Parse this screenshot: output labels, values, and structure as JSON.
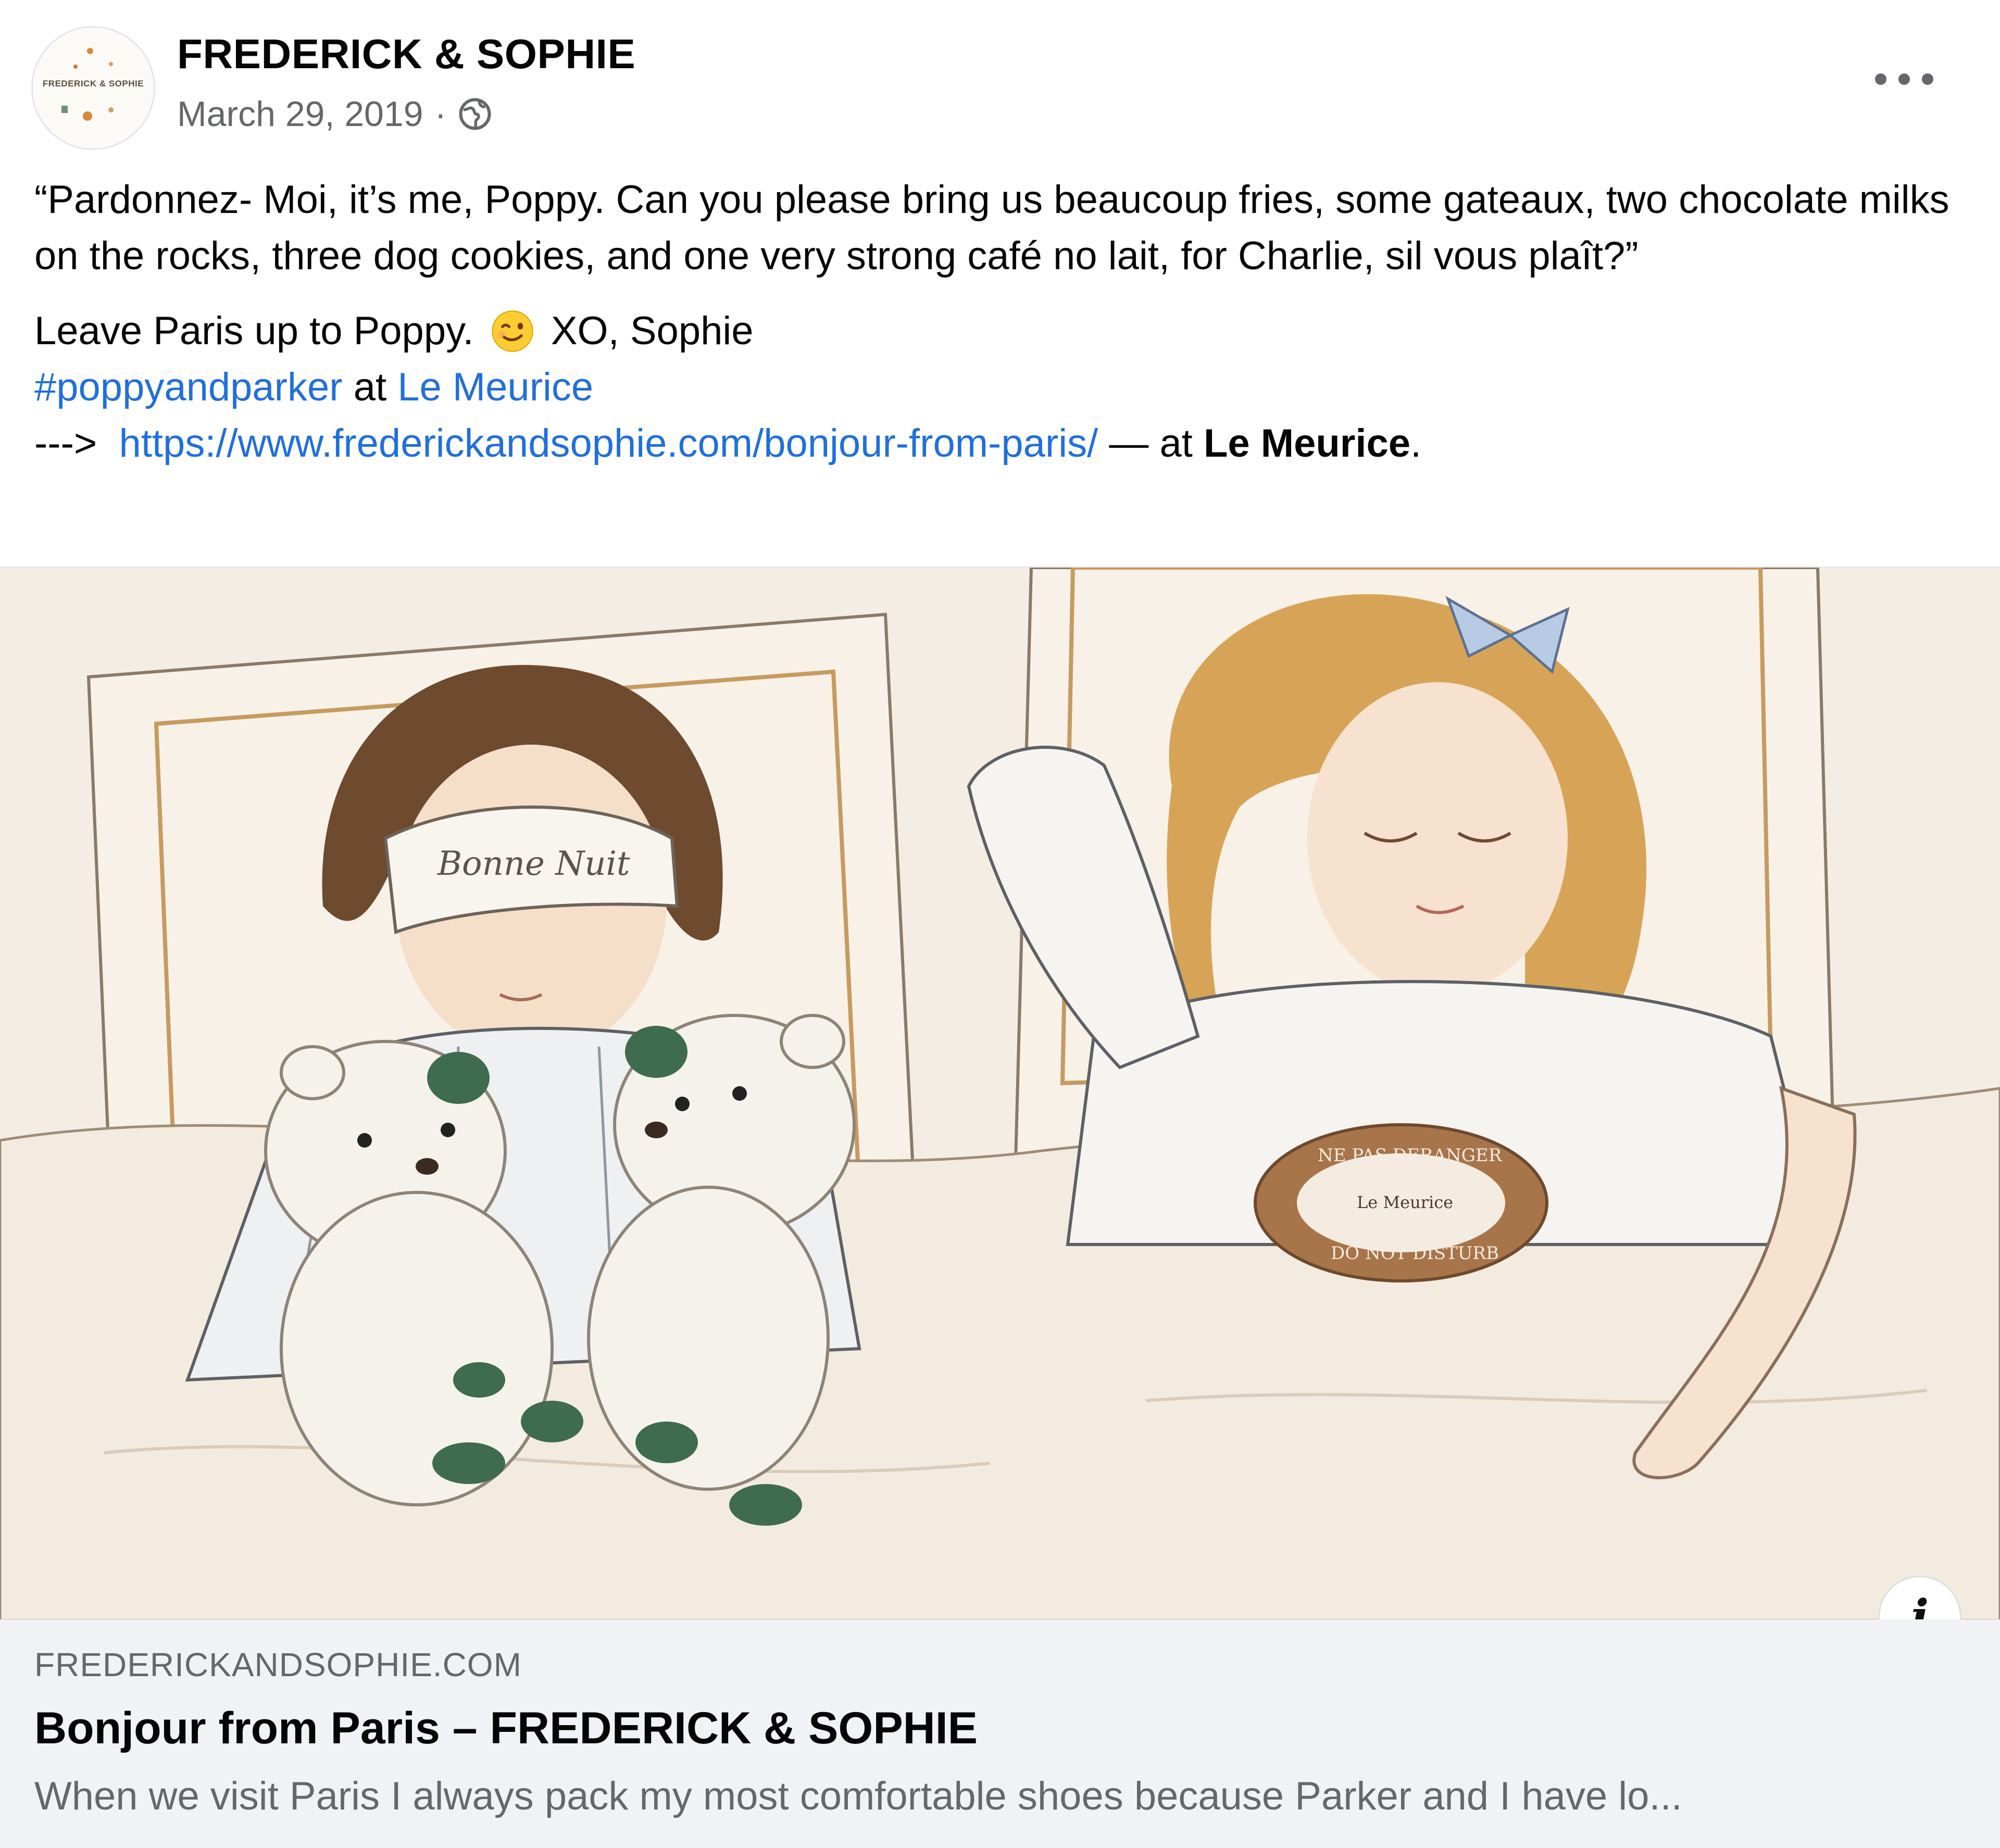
{
  "header": {
    "author": "FREDERICK & SOPHIE",
    "avatar_text": "FREDERICK & SOPHIE",
    "date": "March 29, 2019",
    "separator": "·",
    "audience_icon": "globe-icon",
    "more_icon": "more-options-icon"
  },
  "body": {
    "quote": "“Pardonnez- Moi, it’s me, Poppy. Can you please bring us beaucoup fries, some gateaux, two chocolate milks on the rocks, three dog cookies, and one very strong café no lait, for Charlie, sil vous plaît?”",
    "line2_before": "Leave Paris up to Poppy.",
    "emoji": "winking-face-emoji",
    "line2_after": "XO, Sophie",
    "hashtag": "#poppyandparker",
    "at_word": "at",
    "location_link": "Le Meurice",
    "arrow": "--->",
    "url": "https://www.frederickandsophie.com/bonjour-from-paris/",
    "at_suffix": "— at",
    "location_bold": "Le Meurice",
    "period": "."
  },
  "image": {
    "mask_text": "Bonne Nuit",
    "sign_top": "NE PAS DERANGER",
    "sign_middle": "Le Meurice",
    "sign_bottom": "DO NOT DISTURB",
    "info_icon": "info-icon",
    "info_label": "i"
  },
  "preview": {
    "domain": "FREDERICKANDSOPHIE.COM",
    "title": "Bonjour from Paris – FREDERICK & SOPHIE",
    "description": "When we visit Paris I always pack my most comfortable shoes because Parker and I have lo..."
  },
  "colors": {
    "link": "#216fdb",
    "muted": "#65676b",
    "text": "#050505",
    "preview_bg": "#f0f2f5"
  }
}
